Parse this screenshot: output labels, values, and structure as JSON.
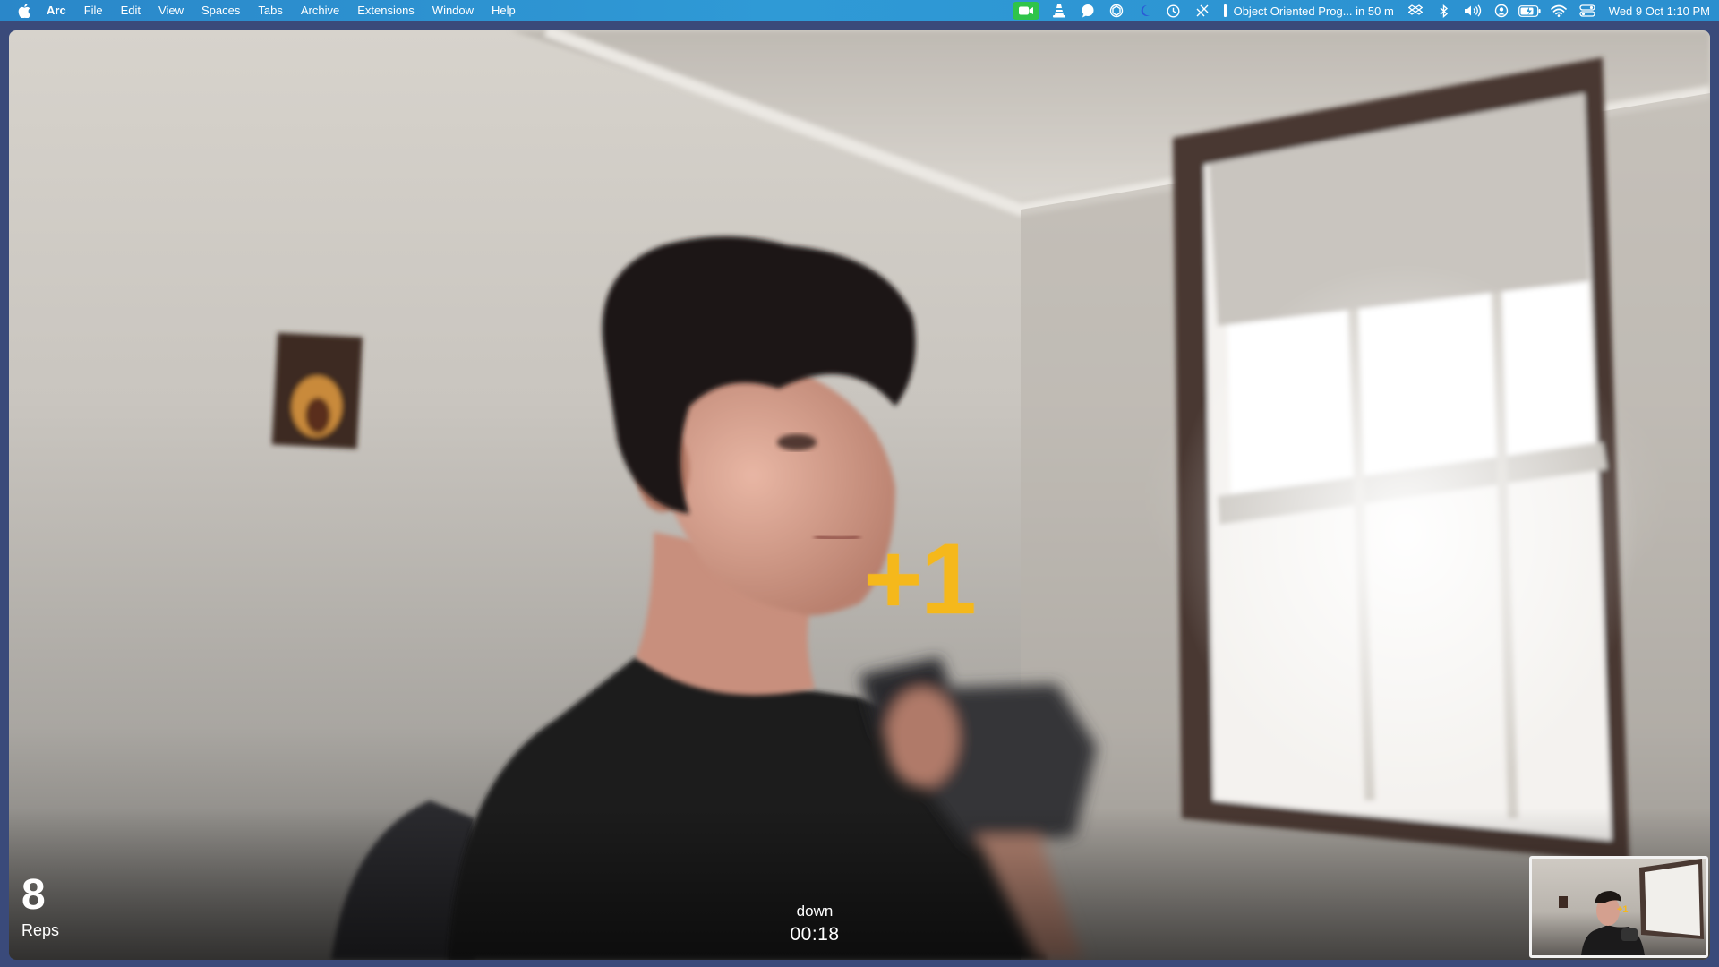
{
  "menubar": {
    "app_name": "Arc",
    "menus": [
      "File",
      "Edit",
      "View",
      "Spaces",
      "Tabs",
      "Archive",
      "Extensions",
      "Window",
      "Help"
    ],
    "tray_icons": [
      "facetime-camera-icon",
      "vlc-cone-icon",
      "chat-bubble-icon",
      "chatgpt-icon",
      "night-shift-icon",
      "clock-icon",
      "raycast-icon"
    ],
    "upcoming_event": "Object Oriented Prog... in 50 m",
    "status_icons": [
      "dropbox-icon",
      "bluetooth-icon",
      "volume-icon",
      "user-icon",
      "battery-icon",
      "wifi-icon",
      "control-center-icon"
    ],
    "datetime": "Wed 9 Oct  1:10 PM",
    "accent_color": "#2f9ad6"
  },
  "workout": {
    "rep_popup": "+1",
    "rep_count": "8",
    "rep_label": "Reps",
    "phase": "down",
    "timer": "00:18",
    "highlight_color": "#f5b81b"
  }
}
